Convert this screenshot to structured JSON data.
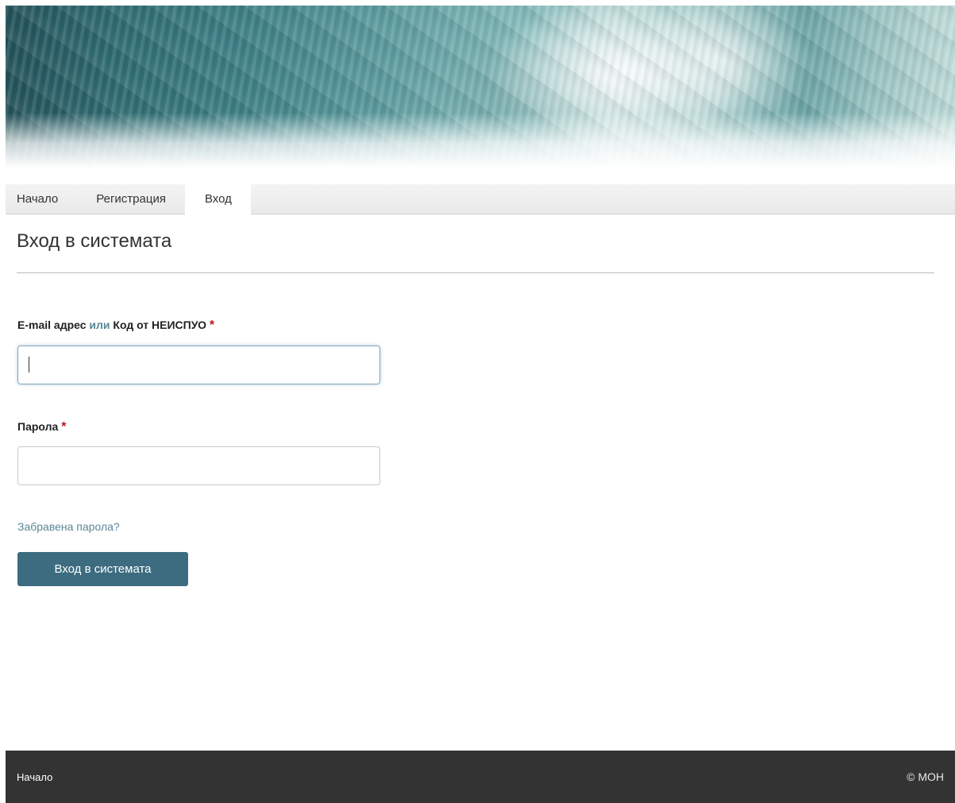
{
  "nav": {
    "items": [
      {
        "label": "Начало"
      },
      {
        "label": "Регистрация"
      },
      {
        "label": "Вход",
        "active": true
      }
    ]
  },
  "main": {
    "title": "Вход в системата",
    "login_field": {
      "label_part1": "E-mail адрес",
      "label_or": "или",
      "label_part2": "Код от НЕИСПУО",
      "required_mark": "*",
      "value": ""
    },
    "password_field": {
      "label": "Парола",
      "required_mark": "*",
      "value": ""
    },
    "forgot_password": "Забравена парола?",
    "submit_label": "Вход в системата"
  },
  "footer": {
    "link": "Начало",
    "copyright": "© МОН"
  },
  "colors": {
    "accent": "#3d6c80",
    "link": "#5b8797",
    "required": "#c0161d",
    "footer_bg": "#333333"
  }
}
